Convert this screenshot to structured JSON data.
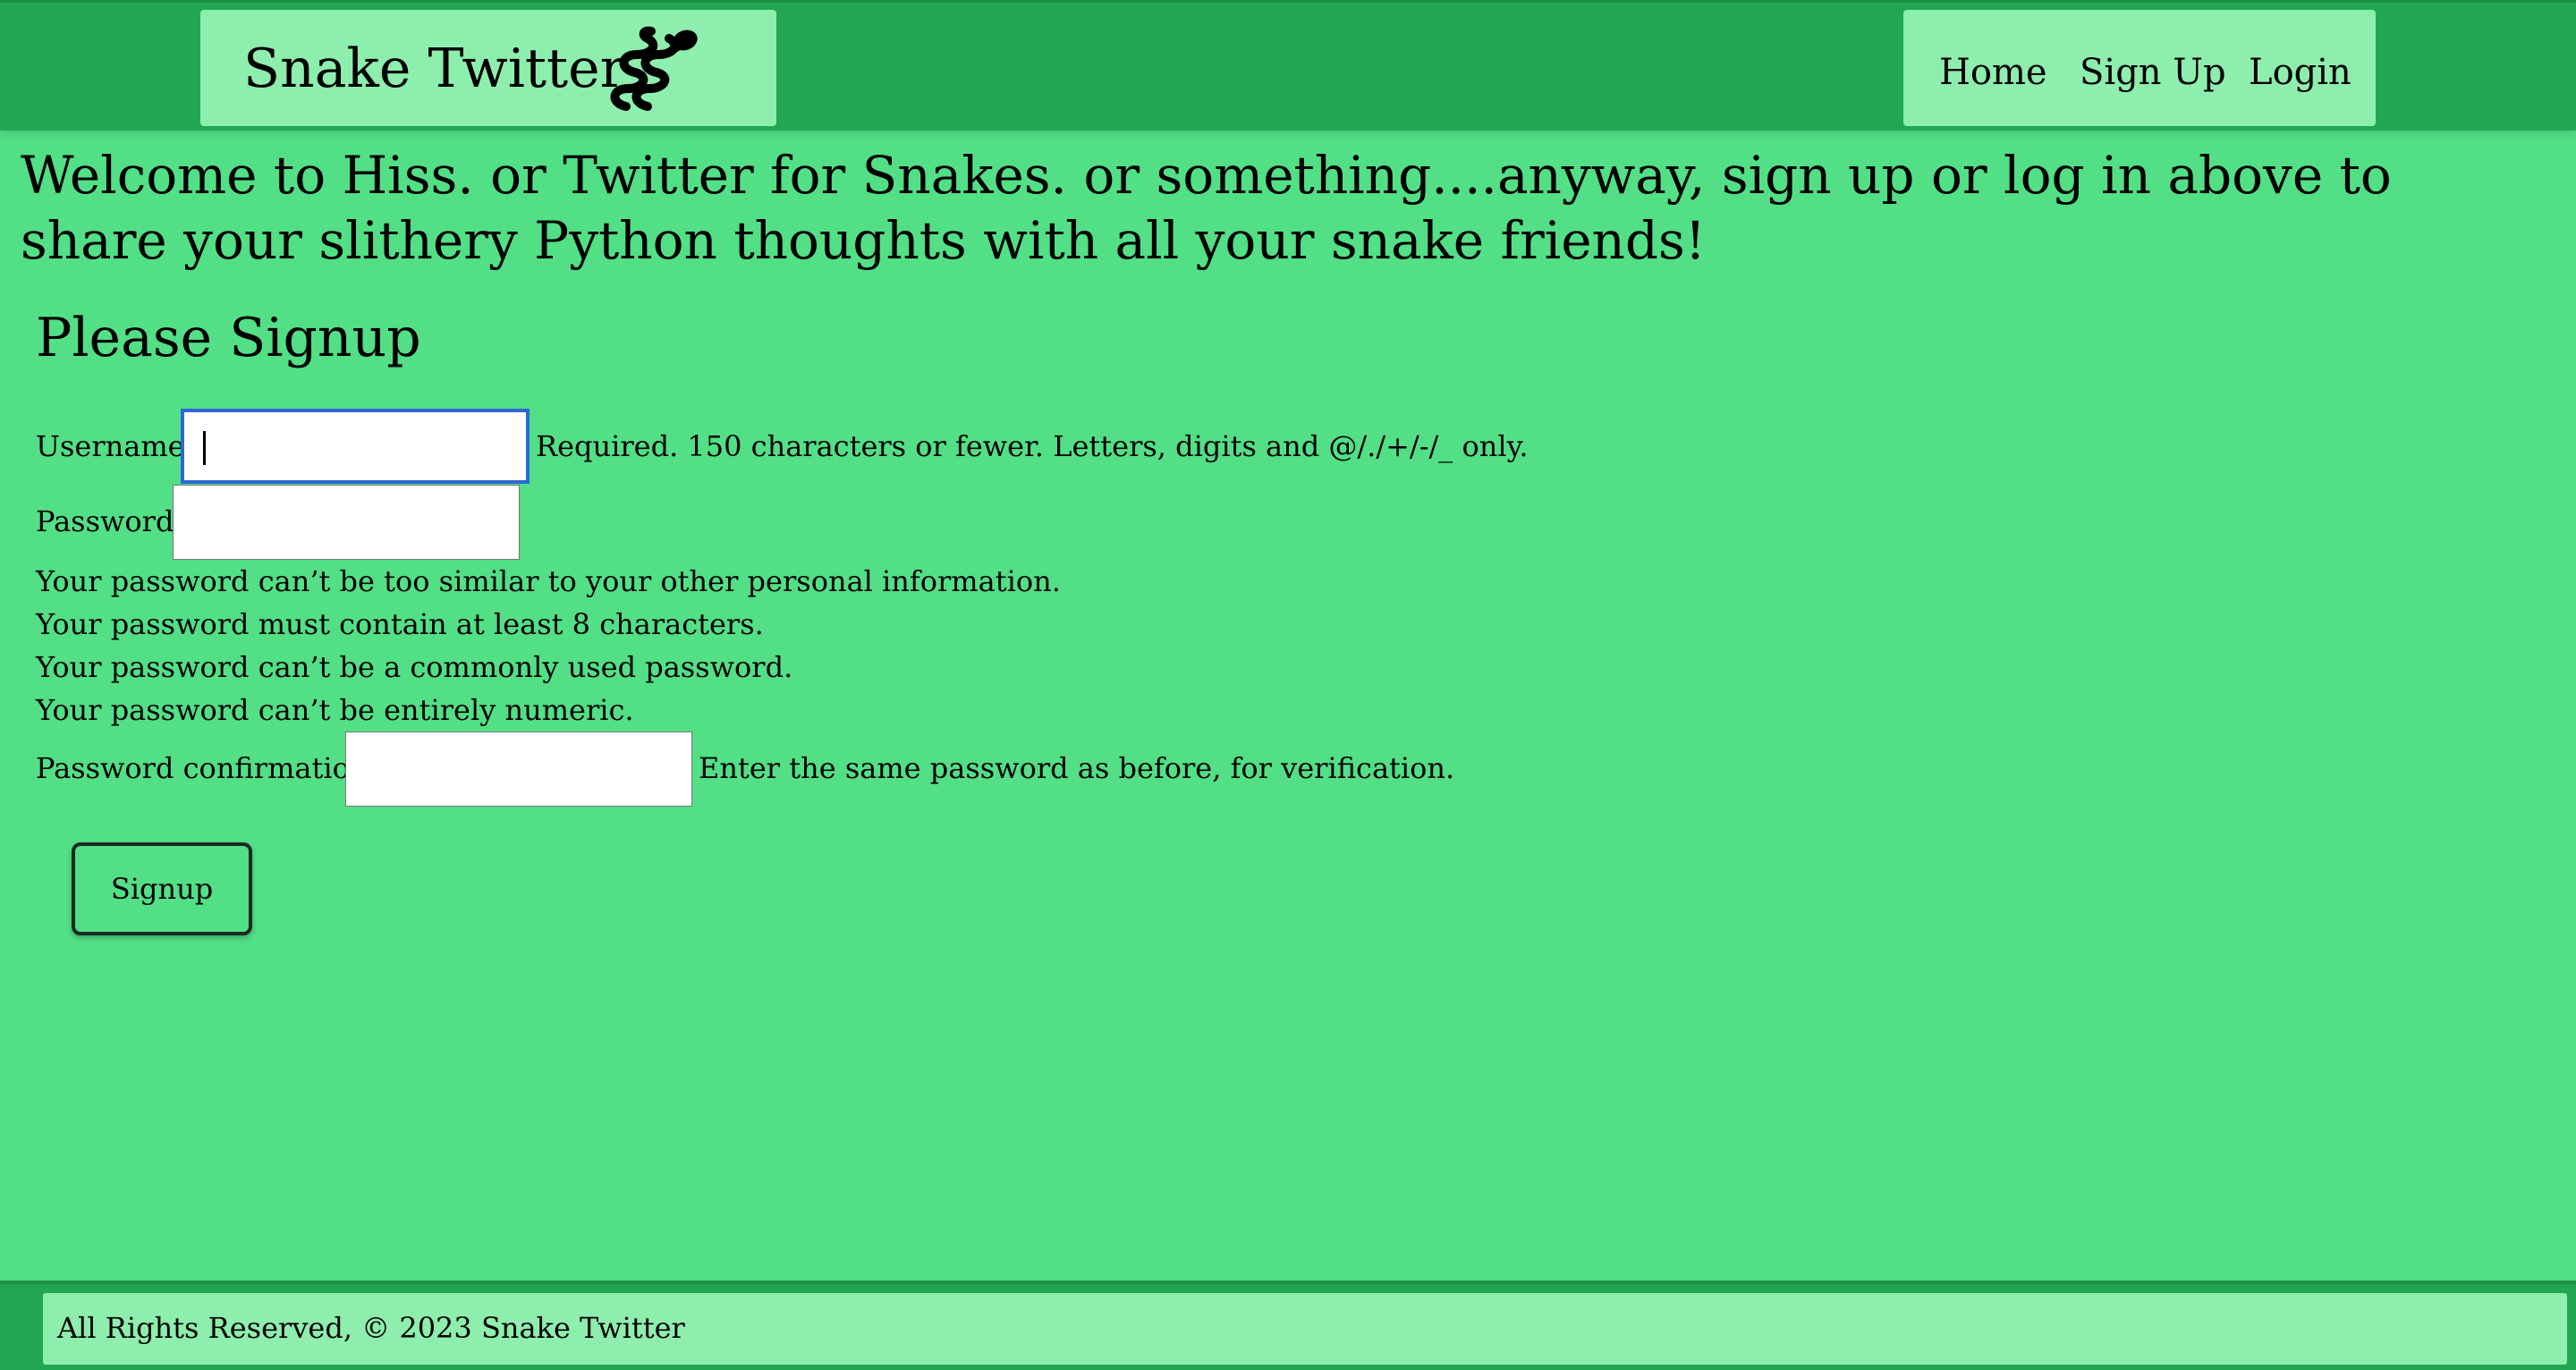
{
  "header": {
    "brand_title": "Snake Twitter",
    "brand_icon": "snake-icon",
    "nav": [
      {
        "label": "Home"
      },
      {
        "label": "Sign Up"
      },
      {
        "label": "Login"
      }
    ]
  },
  "welcome_text": "Welcome to Hiss. or Twitter for Snakes. or something....anyway, sign up or log in above to share your slithery Python thoughts with all your snake friends!",
  "form": {
    "title": "Please Signup",
    "username": {
      "label": "Username:",
      "value": "",
      "help": "Required. 150 characters or fewer. Letters, digits and @/./+/-/_ only."
    },
    "password": {
      "label": "Password:",
      "value": "",
      "help": [
        "Your password can’t be too similar to your other personal information.",
        "Your password must contain at least 8 characters.",
        "Your password can’t be a commonly used password.",
        "Your password can’t be entirely numeric."
      ]
    },
    "password_confirmation": {
      "label": "Password confirmation:",
      "value": "",
      "help": "Enter the same password as before, for verification."
    },
    "submit_label": "Signup"
  },
  "footer": {
    "text": "All Rights Reserved, © 2023 Snake Twitter"
  },
  "colors": {
    "page_bg": "#52df86",
    "header_bg": "#22a653",
    "panel_bg": "#8eeead",
    "focus_ring": "#2e67d4"
  }
}
